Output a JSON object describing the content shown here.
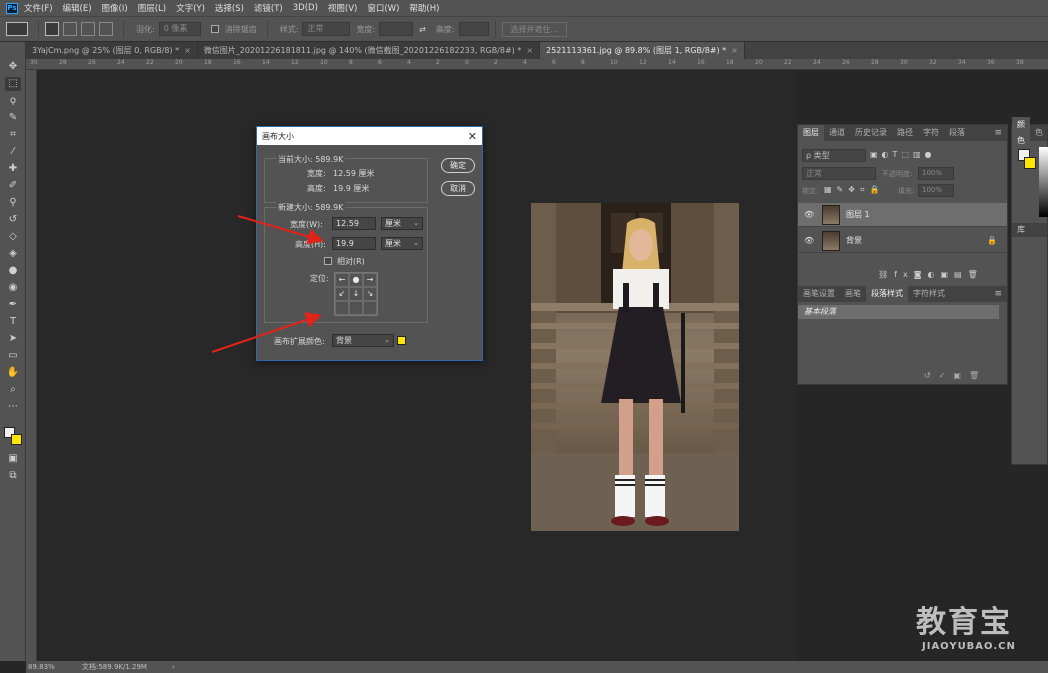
{
  "app": {
    "logo": "Ps"
  },
  "menu": [
    "文件(F)",
    "编辑(E)",
    "图像(I)",
    "图层(L)",
    "文字(Y)",
    "选择(S)",
    "滤镜(T)",
    "3D(D)",
    "视图(V)",
    "窗口(W)",
    "帮助(H)"
  ],
  "options": {
    "feather_label": "羽化:",
    "feather_value": "0 像素",
    "antialias_label": "消除锯齿",
    "style_label": "样式:",
    "style_value": "正常",
    "width_label": "宽度:",
    "height_label": "高度:",
    "select_mask_label": "选择并遮住..."
  },
  "tabs": [
    {
      "label": "3YajCm.png @ 25% (图层 0, RGB/8) *",
      "close": "×"
    },
    {
      "label": "微信图片_20201226181811.jpg @ 140% (微信截图_20201226182233, RGB/8#) *",
      "close": "×"
    },
    {
      "label": "2521113361.jpg @ 89.8% (图层 1, RGB/8#) *",
      "close": "×"
    }
  ],
  "ruler_ticks": [
    "30",
    "28",
    "26",
    "24",
    "22",
    "20",
    "18",
    "16",
    "14",
    "12",
    "10",
    "8",
    "6",
    "4",
    "2",
    "0",
    "2",
    "4",
    "6",
    "8",
    "10",
    "12",
    "14",
    "16",
    "18",
    "20",
    "22",
    "24",
    "26",
    "28",
    "30",
    "32",
    "34",
    "36",
    "38"
  ],
  "dialog": {
    "title": "画布大小",
    "close": "✕",
    "current_size": "当前大小: 589.9K",
    "current_width_label": "宽度:",
    "current_width_value": "12.59 厘米",
    "current_height_label": "高度:",
    "current_height_value": "19.9 厘米",
    "new_size": "新建大小: 589.9K",
    "width_label": "宽度(W):",
    "width_value": "12.59",
    "width_unit": "厘米",
    "height_label": "高度(H):",
    "height_value": "19.9",
    "height_unit": "厘米",
    "relative_label": "相对(R)",
    "anchor_label": "定位:",
    "anchor_cells": [
      "←",
      "●",
      "→",
      "↙",
      "↓",
      "↘",
      "",
      "",
      ""
    ],
    "ok": "确定",
    "cancel": "取消",
    "extension_color_label": "画布扩展颜色:",
    "extension_color_value": "背景",
    "extension_swatch": "#ffe500"
  },
  "layers_panel": {
    "tabs": [
      "图层",
      "通道",
      "历史记录",
      "路径",
      "字符",
      "段落"
    ],
    "filter_kind": "ρ 类型",
    "blend_mode": "正常",
    "opacity_label": "不透明度:",
    "opacity_value": "100%",
    "lock_label": "锁定:",
    "fill_label": "填充:",
    "fill_value": "100%",
    "layers": [
      {
        "name": "图层 1",
        "selected": true,
        "lock": ""
      },
      {
        "name": "背景",
        "selected": false,
        "lock": "🔒"
      }
    ],
    "style_tabs": [
      "画笔设置",
      "画笔",
      "段落样式",
      "字符样式"
    ],
    "style_item": "基本段落"
  },
  "color_panel": {
    "tabs": [
      "颜色",
      "色"
    ],
    "sub_tab": "库"
  },
  "status": {
    "zoom": "89.83%",
    "doc": "文档:589.9K/1.29M",
    "arrow": "›"
  },
  "watermark": {
    "title": "教育宝",
    "subtitle": "JIAOYUBAO.CN"
  },
  "colors": {
    "accent": "#31a8ff",
    "arrow_red": "#e2231a",
    "swatch_bg": "#ffe500"
  }
}
